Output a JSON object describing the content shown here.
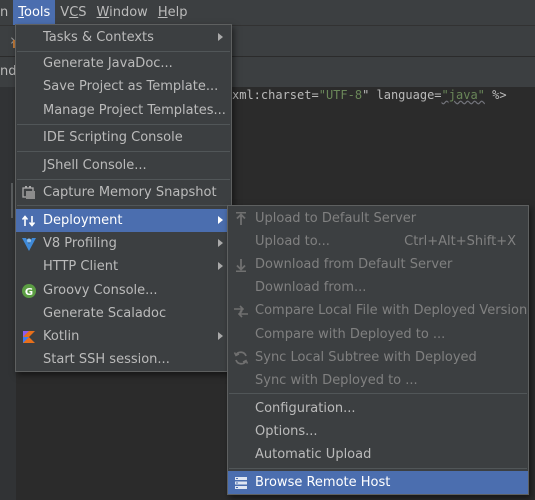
{
  "menubar": {
    "items": [
      {
        "label": "n"
      },
      {
        "label": "Tools"
      },
      {
        "label": "VCS"
      },
      {
        "label": "Window"
      },
      {
        "label": "Help"
      }
    ]
  },
  "editor": {
    "tab_fragment": "nd",
    "code": {
      "part1": "xml:charset=",
      "part2": "UTF-8",
      "part3": "\" language=",
      "part4": "\"java\"",
      "part5": " %>"
    }
  },
  "tools_menu": {
    "items": [
      {
        "label": "Tasks & Contexts",
        "submenu": true
      },
      {
        "label": "Generate JavaDoc..."
      },
      {
        "label": "Save Project as Template..."
      },
      {
        "label": "Manage Project Templates..."
      },
      {
        "label": "IDE Scripting Console"
      },
      {
        "label": "JShell Console..."
      },
      {
        "label": "Capture Memory Snapshot",
        "icon": "memory-snapshot-icon"
      },
      {
        "label": "Deployment",
        "submenu": true,
        "selected": true,
        "icon": "deployment-icon"
      },
      {
        "label": "V8 Profiling",
        "submenu": true,
        "icon": "v8-icon"
      },
      {
        "label": "HTTP Client",
        "submenu": true
      },
      {
        "label": "Groovy Console...",
        "icon": "groovy-icon"
      },
      {
        "label": "Generate Scaladoc"
      },
      {
        "label": "Kotlin",
        "submenu": true,
        "icon": "kotlin-icon"
      },
      {
        "label": "Start SSH session..."
      }
    ]
  },
  "deployment_menu": {
    "items": [
      {
        "label": "Upload to Default Server",
        "disabled": true,
        "icon": "upload-icon"
      },
      {
        "label": "Upload to...",
        "shortcut": "Ctrl+Alt+Shift+X",
        "disabled": true
      },
      {
        "label": "Download from Default Server",
        "disabled": true,
        "icon": "download-icon"
      },
      {
        "label": "Download from...",
        "disabled": true
      },
      {
        "label": "Compare Local File with Deployed Version",
        "disabled": true,
        "icon": "compare-icon"
      },
      {
        "label": "Compare with Deployed to ...",
        "disabled": true
      },
      {
        "label": "Sync Local Subtree with Deployed",
        "disabled": true,
        "icon": "sync-icon"
      },
      {
        "label": "Sync with Deployed to ...",
        "disabled": true
      },
      {
        "label": "Configuration..."
      },
      {
        "label": "Options..."
      },
      {
        "label": "Automatic Upload"
      },
      {
        "label": "Browse Remote Host",
        "selected": true,
        "icon": "browse-remote-host-icon"
      }
    ]
  },
  "colors": {
    "menu_bg": "#3c3f41",
    "selection": "#4b6eaf",
    "text": "#bbbbbb",
    "disabled_text": "#808080",
    "editor_bg": "#2b2b2b"
  }
}
